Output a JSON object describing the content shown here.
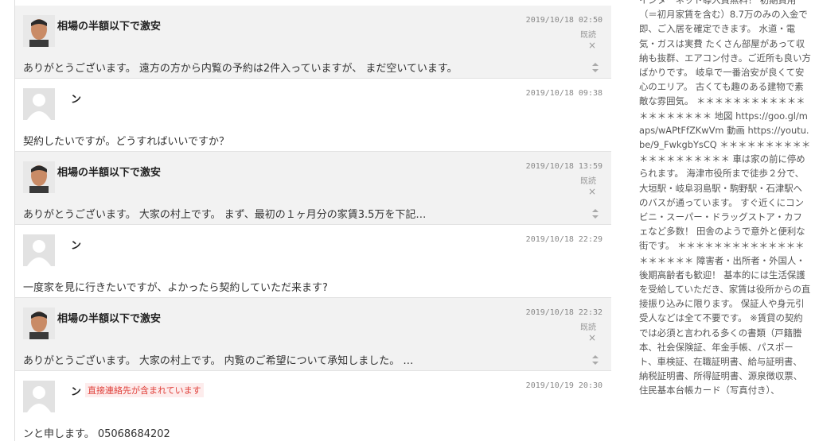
{
  "messages": [
    {
      "type": "host",
      "name": "相場の半額以下で激安",
      "date": "2019/10/18 02:50",
      "status": "既読",
      "close": "×",
      "body": "ありがとうございます。 遠方の方から内覧の予約は2件入っていますが、 まだ空いています。"
    },
    {
      "type": "guest",
      "name": "ン",
      "date": "2019/10/18 09:38",
      "body": "契約したいですが。どうすればいいですか？"
    },
    {
      "type": "host",
      "name": "相場の半額以下で激安",
      "date": "2019/10/18 13:59",
      "status": "既読",
      "close": "×",
      "body": "ありがとうございます。 大家の村上です。 まず、最初の１ヶ月分の家賃3.5万を下記…"
    },
    {
      "type": "guest",
      "name": "ン",
      "date": "2019/10/18 22:29",
      "body": "一度家を見に行きたいですが、よかったら契約していただ来ます?"
    },
    {
      "type": "host",
      "name": "相場の半額以下で激安",
      "date": "2019/10/18 22:32",
      "status": "既読",
      "close": "×",
      "body": "ありがとうございます。 大家の村上です。 内覧のご希望について承知しました。 …"
    },
    {
      "type": "guest",
      "name": "ン",
      "date": "2019/10/19 20:30",
      "warning": "直接連絡先が含まれています",
      "body": "ンと申します。 05068684202"
    }
  ],
  "sidebar": {
    "description": "インターネット導入費無料！ 初期費用（＝初月家賃を含む）8.7万のみの入金で即、ご入居を確定できます。 水道・電気・ガスは実費 たくさん部屋があって収納も抜群、エアコン付き。ご近所も良い方ばかりです。 岐阜で一番治安が良くて安心のエリア。 古くても趣のある建物で素敵な雰囲気。 ＊＊＊＊＊＊＊＊＊＊＊＊＊＊＊＊＊＊＊＊ 地図 https://goo.gl/maps/wAPtFfZKwVm 動画 https://youtu.be/9_FwkgbYsCQ ＊＊＊＊＊＊＊＊＊＊＊＊＊＊＊＊＊＊＊＊ 車は家の前に停められます。 海津市役所まで徒歩２分で、大垣駅・岐阜羽島駅・駒野駅・石津駅へのバスが通っています。 すぐ近くにコンビニ・スーパー・ドラッグストア・カフェなど多数！ 田舎のようで意外と便利な街です。 ＊＊＊＊＊＊＊＊＊＊＊＊＊＊＊＊＊＊＊＊ 障害者・出所者・外国人・後期高齢者も歓迎！ 基本的には生活保護を受給していただき、家賃は役所からの直接振り込みに限ります。 保証人や身元引受人などは全て不要です。 ※賃貸の契約では必須と言われる多くの書類（戸籍謄本、社会保険証、年金手帳、パスポート、車検証、在職証明書、給与証明書、納税証明書、所得証明書、源泉徴収票、住民基本台帳カード（写真付き）、"
  }
}
